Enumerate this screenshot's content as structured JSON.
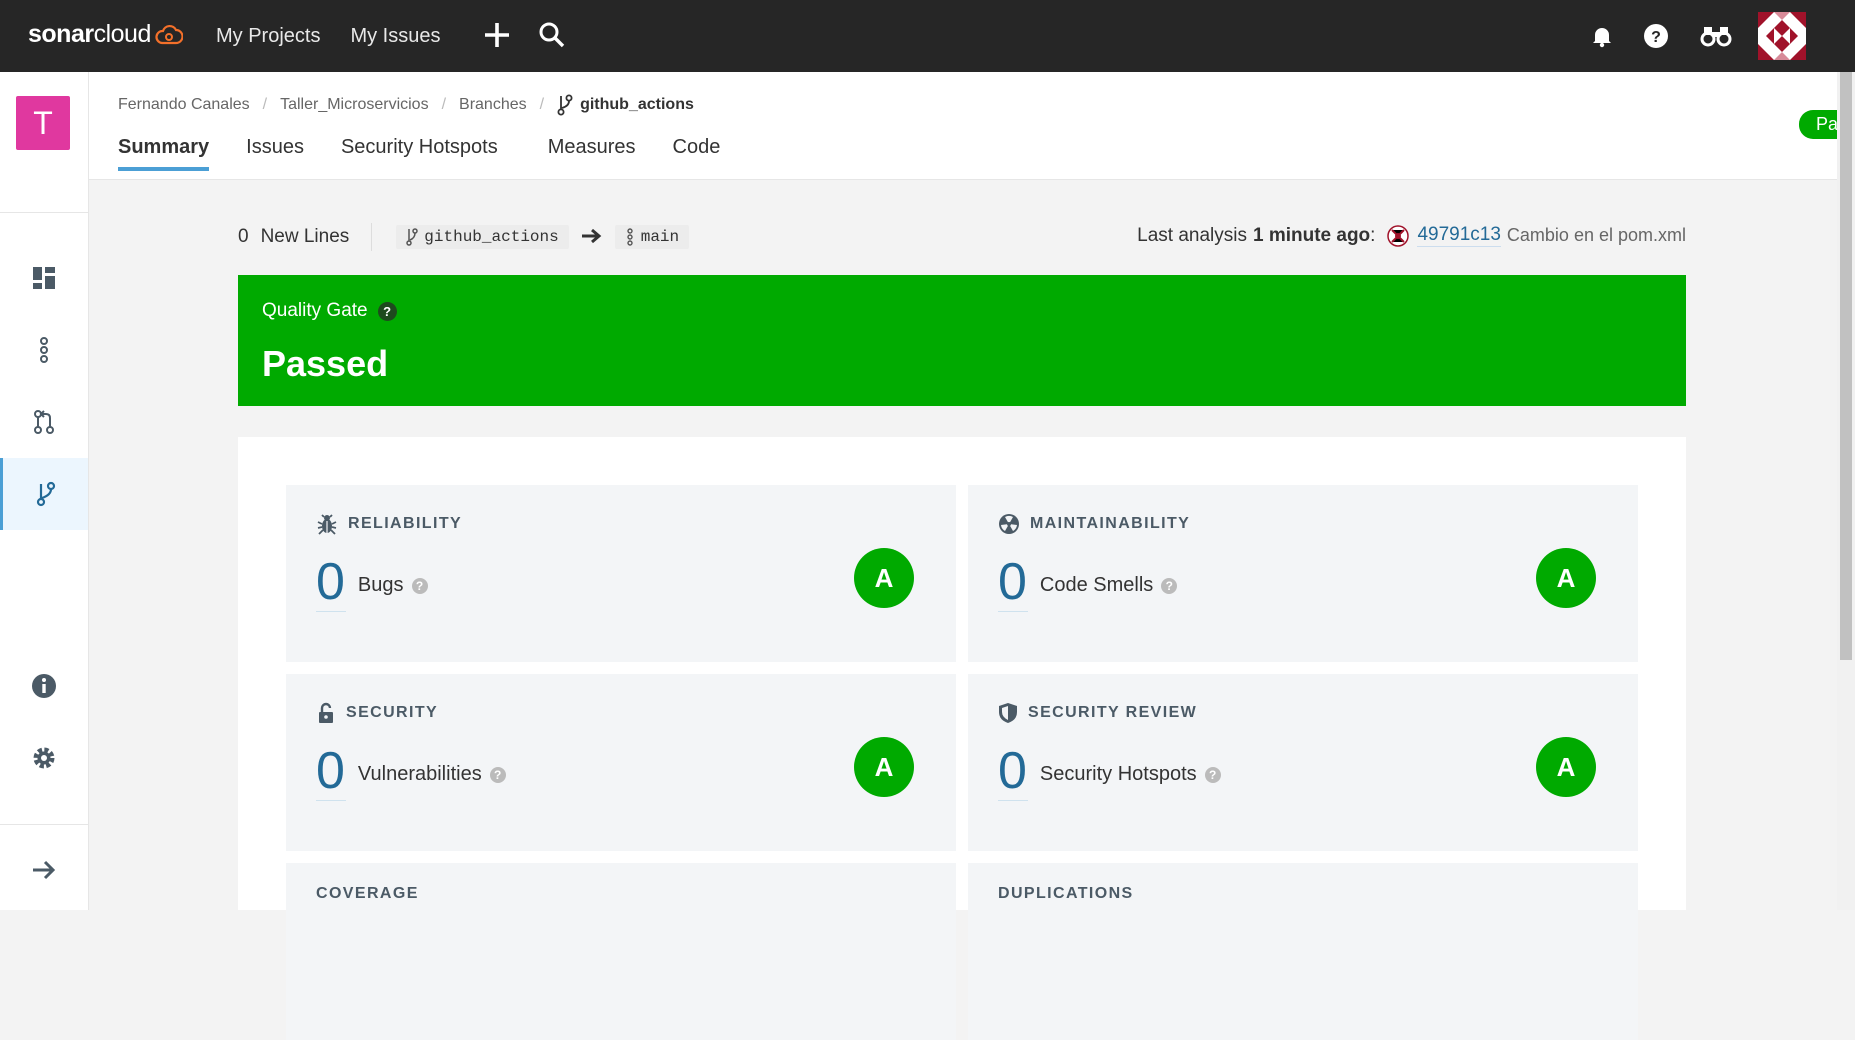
{
  "topbar": {
    "logo_bold": "sonar",
    "logo_light": "cloud",
    "nav": [
      "My Projects",
      "My Issues"
    ],
    "icons": [
      "plus-icon",
      "search-icon",
      "bell-icon",
      "help-icon",
      "binoculars-icon"
    ]
  },
  "project": {
    "avatar_letter": "T"
  },
  "breadcrumb": {
    "items": [
      "Fernando Canales",
      "Taller_Microservicios",
      "Branches"
    ],
    "current": "github_actions"
  },
  "tabs": [
    "Summary",
    "Issues",
    "Security Hotspots",
    "Measures",
    "Code"
  ],
  "status_pill": "Passed",
  "infoline": {
    "new_lines_count": "0",
    "new_lines_label": "New Lines",
    "from_branch": "github_actions",
    "to_branch": "main",
    "last_analysis_label": "Last analysis",
    "last_analysis_time": "1 minute ago",
    "colon": ":",
    "commit_hash": "49791c13",
    "commit_message": "Cambio en el pom.xml"
  },
  "quality_gate": {
    "title": "Quality Gate",
    "help": "?",
    "status": "Passed"
  },
  "cards": [
    {
      "title": "RELIABILITY",
      "value": "0",
      "label": "Bugs",
      "rating": "A"
    },
    {
      "title": "MAINTAINABILITY",
      "value": "0",
      "label": "Code Smells",
      "rating": "A"
    },
    {
      "title": "SECURITY",
      "value": "0",
      "label": "Vulnerabilities",
      "rating": "A"
    },
    {
      "title": "SECURITY REVIEW",
      "value": "0",
      "label": "Security Hotspots",
      "rating": "A"
    },
    {
      "title": "COVERAGE"
    },
    {
      "title": "DUPLICATIONS"
    }
  ],
  "colors": {
    "topbar": "#262626",
    "passed_green": "#00aa00",
    "link_blue": "#236a97",
    "project_pink": "#e0389f"
  }
}
